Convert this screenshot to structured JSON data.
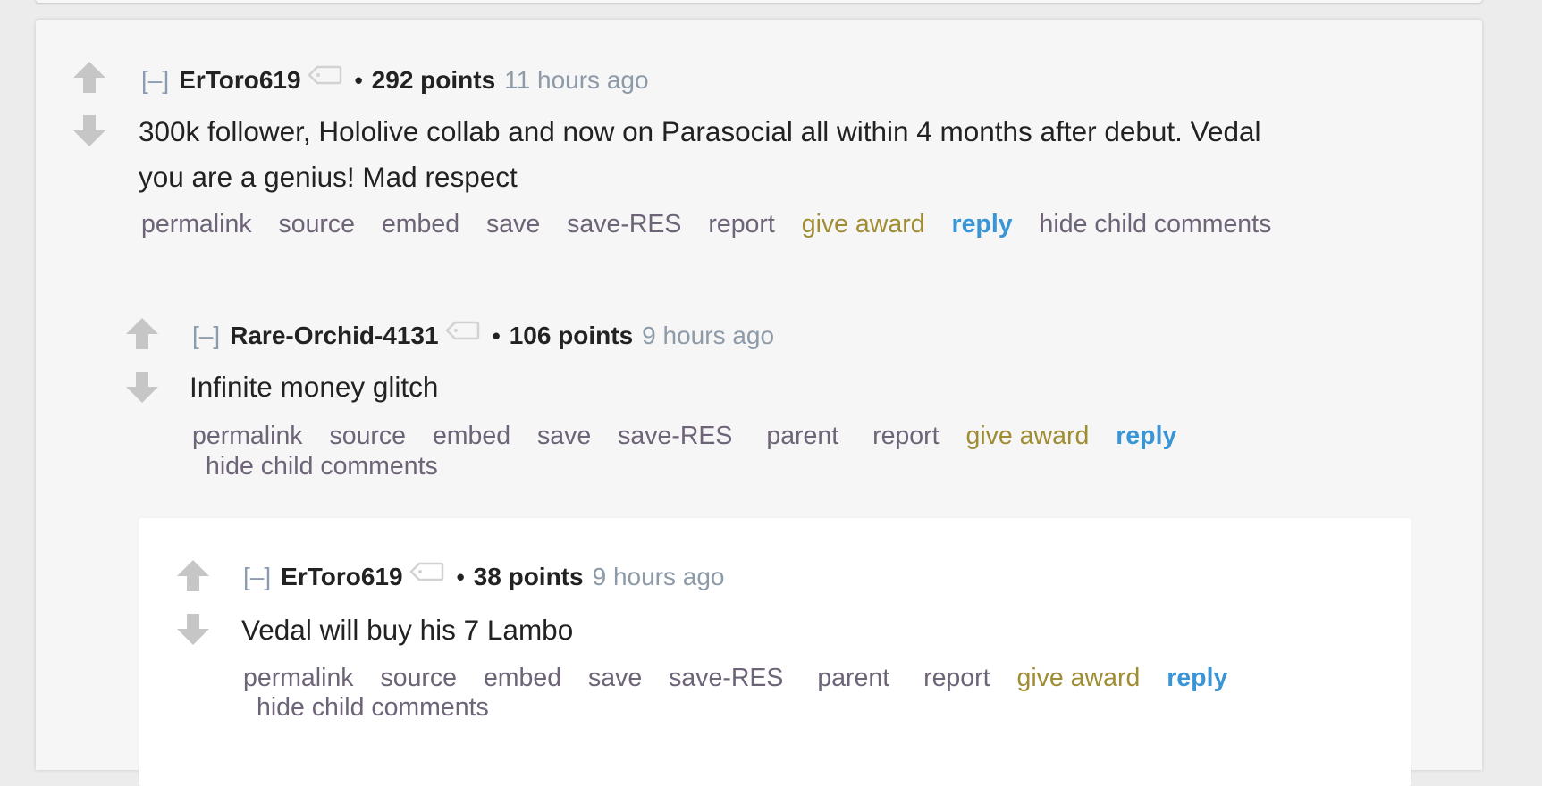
{
  "comments": [
    {
      "collapse": "[–]",
      "author": "ErToro619",
      "bullet": "•",
      "score": "292 points",
      "time": "11 hours ago",
      "body_lines": [
        "300k follower, Hololive collab and now on Parasocial all within 4 months after debut. Vedal",
        "you are a genius! Mad respect"
      ],
      "actions": {
        "permalink": "permalink",
        "source": "source",
        "embed": "embed",
        "save": "save",
        "save_res": "save-RES",
        "report": "report",
        "give_award": "give award",
        "reply": "reply",
        "hide_child": "hide child comments"
      }
    },
    {
      "collapse": "[–]",
      "author": "Rare-Orchid-4131",
      "bullet": "•",
      "score": "106 points",
      "time": "9 hours ago",
      "body_lines": [
        "Infinite money glitch"
      ],
      "actions": {
        "permalink": "permalink",
        "source": "source",
        "embed": "embed",
        "save": "save",
        "save_res": "save-RES",
        "parent": "parent",
        "report": "report",
        "give_award": "give award",
        "reply": "reply",
        "hide_child": "hide child comments"
      }
    },
    {
      "collapse": "[–]",
      "author": "ErToro619",
      "bullet": "•",
      "score": "38 points",
      "time": "9 hours ago",
      "body_lines": [
        "Vedal will buy his 7 Lambo"
      ],
      "actions": {
        "permalink": "permalink",
        "source": "source",
        "embed": "embed",
        "save": "save",
        "save_res": "save-RES",
        "parent": "parent",
        "report": "report",
        "give_award": "give award",
        "reply": "reply",
        "hide_child": "hide child comments"
      }
    }
  ],
  "icons": {
    "upvote": "upvote-arrow-icon",
    "downvote": "downvote-arrow-icon",
    "tag": "user-tag-icon"
  },
  "colors": {
    "background": "#ececec",
    "panel": "#f6f6f6",
    "nested_panel": "#ffffff",
    "author": "#222222",
    "collapse": "#8b9bb0",
    "time": "#8d9aa8",
    "action_link": "#6e6478",
    "give_award": "#a08d33",
    "reply": "#3a95d6",
    "arrow": "#c6c6c6"
  }
}
